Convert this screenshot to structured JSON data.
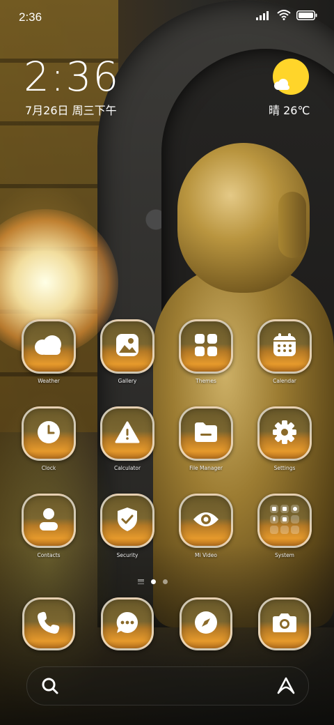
{
  "status_bar": {
    "time": "2:36",
    "icons": [
      "signal-icon",
      "wifi-icon",
      "battery-icon"
    ]
  },
  "clock_widget": {
    "time": "2:36",
    "date": "7月26日 周三下午"
  },
  "weather_widget": {
    "text": "晴 26℃",
    "icon": "sun-cloud-icon"
  },
  "apps": [
    {
      "label": "Weather",
      "icon": "cloud-icon"
    },
    {
      "label": "Gallery",
      "icon": "image-icon"
    },
    {
      "label": "Themes",
      "icon": "grid-icon"
    },
    {
      "label": "Calendar",
      "icon": "calendar-icon"
    },
    {
      "label": "Clock",
      "icon": "clock-icon"
    },
    {
      "label": "Calculator",
      "icon": "warning-icon"
    },
    {
      "label": "File Manager",
      "icon": "folder-icon"
    },
    {
      "label": "Settings",
      "icon": "gear-icon"
    },
    {
      "label": "Contacts",
      "icon": "person-icon"
    },
    {
      "label": "Security",
      "icon": "shield-check-icon"
    },
    {
      "label": "Mi Video",
      "icon": "eye-icon"
    },
    {
      "label": "System",
      "icon": "folder-grid-icon"
    }
  ],
  "dock": [
    {
      "name": "phone",
      "icon": "phone-icon"
    },
    {
      "name": "messages",
      "icon": "chat-icon"
    },
    {
      "name": "browser",
      "icon": "compass-icon"
    },
    {
      "name": "camera",
      "icon": "camera-icon"
    }
  ],
  "pager": {
    "pages": 2,
    "active": 1
  },
  "colors": {
    "accent_orange": "#e69a2c",
    "sun_yellow": "#ffd52a",
    "icon_border": "#f0ebe1"
  }
}
